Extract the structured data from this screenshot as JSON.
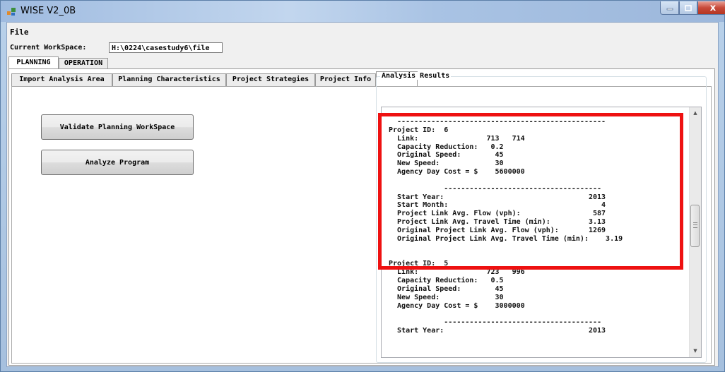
{
  "window": {
    "title": "WISE V2_0B",
    "close_glyph": "x",
    "colors": {
      "highlight": "#ee1111",
      "title_bar": "#b9d1ea",
      "close_button": "#c74a3a"
    }
  },
  "menu": {
    "file": "File"
  },
  "workspace": {
    "label": "Current WorkSpace:",
    "value": "H:\\0224\\casestudy6\\file"
  },
  "main_tabs": [
    {
      "label": "PLANNING",
      "active": true
    },
    {
      "label": "OPERATION",
      "active": false
    }
  ],
  "planning_tabs": [
    {
      "label": "Import Analysis Area",
      "active": false
    },
    {
      "label": "Planning Characteristics",
      "active": false
    },
    {
      "label": "Project Strategies",
      "active": false
    },
    {
      "label": "Project Info",
      "active": false
    },
    {
      "label": "Results",
      "active": true
    }
  ],
  "buttons": {
    "validate": "Validate Planning WorkSpace",
    "analyze": "Analyze Program"
  },
  "results": {
    "group_title": "Analysis Results",
    "lines": [
      "  -------------------------------------------------",
      "Project ID:  6",
      "  Link:                713   714",
      "  Capacity Reduction:   0.2",
      "  Original Speed:        45",
      "  New Speed:             30",
      "  Agency Day Cost = $    5600000",
      "",
      "             -------------------------------------",
      "  Start Year:                                  2013",
      "  Start Month:                                    4",
      "  Project Link Avg. Flow (vph):                 587",
      "  Project Link Avg. Travel Time (min):         3.13",
      "  Original Project Link Avg. Flow (vph):       1269",
      "  Original Project Link Avg. Travel Time (min):    3.19",
      "",
      "",
      "Project ID:  5",
      "  Link:                723   996",
      "  Capacity Reduction:   0.5",
      "  Original Speed:        45",
      "  New Speed:             30",
      "  Agency Day Cost = $    3000000",
      "",
      "             -------------------------------------",
      "  Start Year:                                  2013"
    ]
  }
}
